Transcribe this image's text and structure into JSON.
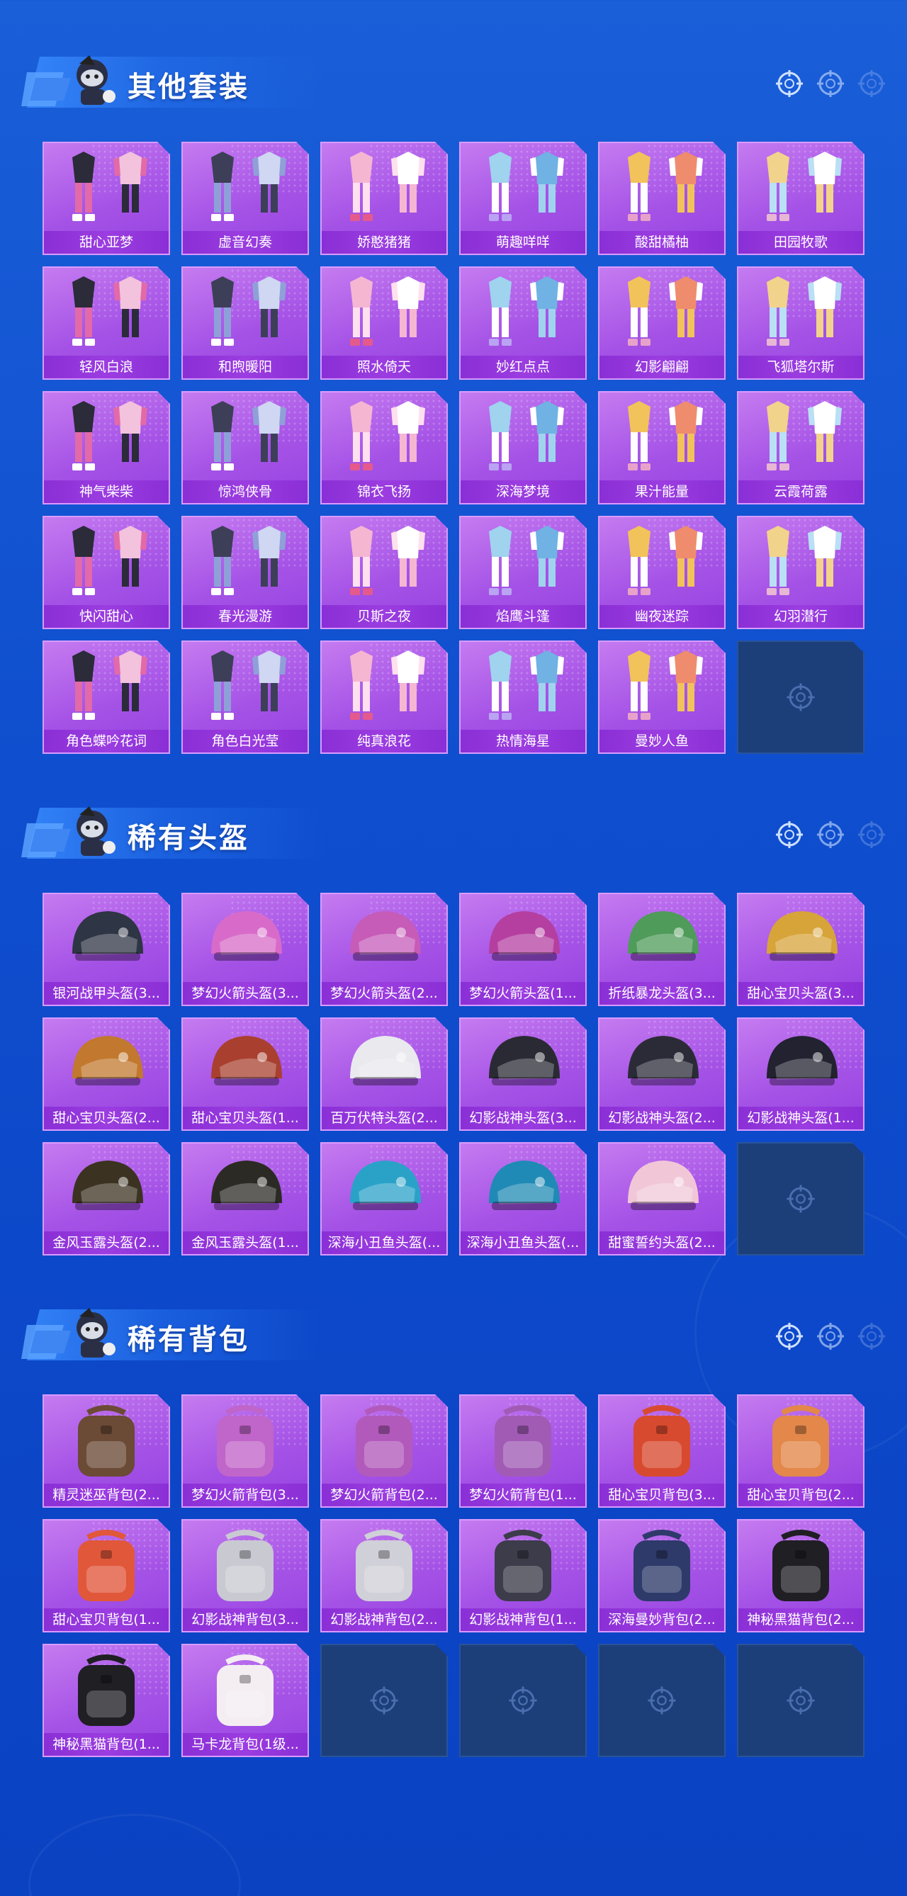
{
  "colors": {
    "background": "#0f4fcf",
    "card_purple": "#a553e6",
    "label_purple": "#8a2fd6",
    "empty_slot": "#1c3f7a"
  },
  "sections": [
    {
      "title": "其他套装",
      "icon": "soldier-emblem-icon",
      "items": [
        "甜心亚梦",
        "虚音幻奏",
        "娇憨猪猪",
        "萌趣咩咩",
        "酸甜橘柚",
        "田园牧歌",
        "轻风白浪",
        "和煦暖阳",
        "照水倚天",
        "妙红点点",
        "幻影翩翩",
        "飞狐塔尔斯",
        "神气柴柴",
        "惊鸿侠骨",
        "锦衣飞扬",
        "深海梦境",
        "果汁能量",
        "云霞荷露",
        "快闪甜心",
        "春光漫游",
        "贝斯之夜",
        "焰鹰斗篷",
        "幽夜迷踪",
        "幻羽潜行",
        "角色蝶吟花词",
        "角色白光莹",
        "纯真浪花",
        "热情海星",
        "曼妙人鱼"
      ],
      "empty_slots": 1
    },
    {
      "title": "稀有头盔",
      "icon": "soldier-emblem-icon",
      "items": [
        "银河战甲头盔(3...",
        "梦幻火箭头盔(3...",
        "梦幻火箭头盔(2...",
        "梦幻火箭头盔(1...",
        "折纸暴龙头盔(3...",
        "甜心宝贝头盔(3...",
        "甜心宝贝头盔(2...",
        "甜心宝贝头盔(1...",
        "百万伏特头盔(2...",
        "幻影战神头盔(3...",
        "幻影战神头盔(2...",
        "幻影战神头盔(1...",
        "金风玉露头盔(2...",
        "金风玉露头盔(1...",
        "深海小丑鱼头盔(...",
        "深海小丑鱼头盔(...",
        "甜蜜誓约头盔(2..."
      ],
      "empty_slots": 1
    },
    {
      "title": "稀有背包",
      "icon": "soldier-emblem-icon",
      "items": [
        "精灵迷巫背包(2...",
        "梦幻火箭背包(3...",
        "梦幻火箭背包(2...",
        "梦幻火箭背包(1...",
        "甜心宝贝背包(3...",
        "甜心宝贝背包(2...",
        "甜心宝贝背包(1...",
        "幻影战神背包(3...",
        "幻影战神背包(2...",
        "幻影战神背包(1...",
        "深海曼妙背包(2...",
        "神秘黑猫背包(2...",
        "神秘黑猫背包(1...",
        "马卡龙背包(1级..."
      ],
      "empty_slots": 4
    }
  ]
}
